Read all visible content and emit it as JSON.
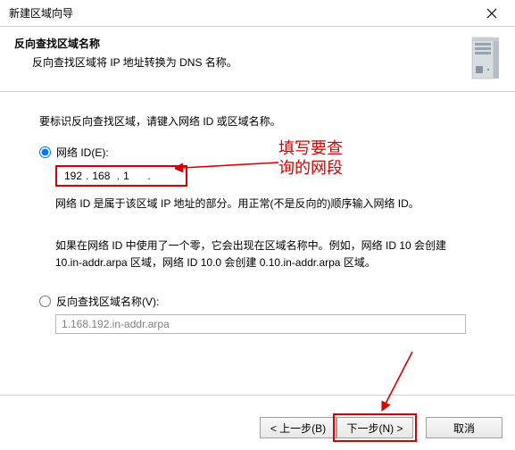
{
  "window": {
    "title": "新建区域向导"
  },
  "header": {
    "title": "反向查找区域名称",
    "desc": "反向查找区域将 IP 地址转换为 DNS 名称。"
  },
  "body": {
    "intro": "要标识反向查找区域，请键入网络 ID 或区域名称。",
    "radio_network": "网络 ID(E):",
    "ip_a": "192",
    "ip_b": "168",
    "ip_c": "1",
    "help1": "网络 ID 是属于该区域 IP 地址的部分。用正常(不是反向的)顺序输入网络 ID。",
    "help2": "如果在网络 ID 中使用了一个零，它会出现在区域名称中。例如，网络 ID 10 会创建 10.in-addr.arpa 区域，网络 ID 10.0 会创建 0.10.in-addr.arpa 区域。",
    "radio_zone": "反向查找区域名称(V):",
    "zone_value": "1.168.192.in-addr.arpa"
  },
  "footer": {
    "back": "< 上一步(B)",
    "next": "下一步(N) >",
    "cancel": "取消"
  },
  "annotation": {
    "line1": "填写要查",
    "line2": "询的网段"
  }
}
